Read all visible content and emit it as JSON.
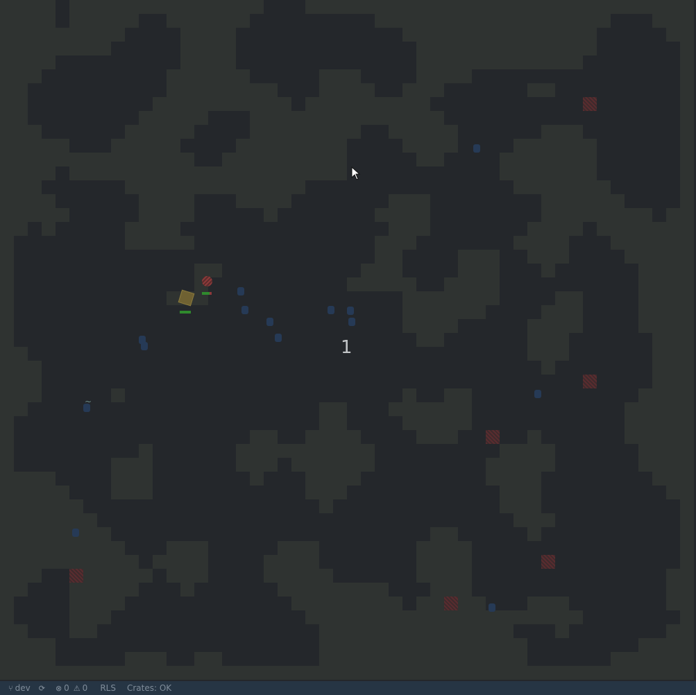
{
  "game": {
    "wave_counter": "1",
    "cursor": "arrow-pointer-icon",
    "colors": {
      "background": "#24272b",
      "wall": "#2f3331",
      "hazard": "#5a2c2f",
      "pellet": "#263a56",
      "player": "#6f6132",
      "health": "#2f8a2d",
      "enemy": "#8c3a3a"
    },
    "player": {
      "health_fraction": 1.0
    },
    "enemy": {
      "health_fraction": 0.8
    },
    "wave_glyph": "~"
  },
  "statusbar": {
    "branch_icon": "git-branch-icon",
    "branch": "dev",
    "sync_icon": "sync-icon",
    "errors_icon": "error-circle-icon",
    "errors": "0",
    "warnings_icon": "warning-triangle-icon",
    "warnings": "0",
    "rls": "RLS",
    "crates": "Crates: OK"
  }
}
